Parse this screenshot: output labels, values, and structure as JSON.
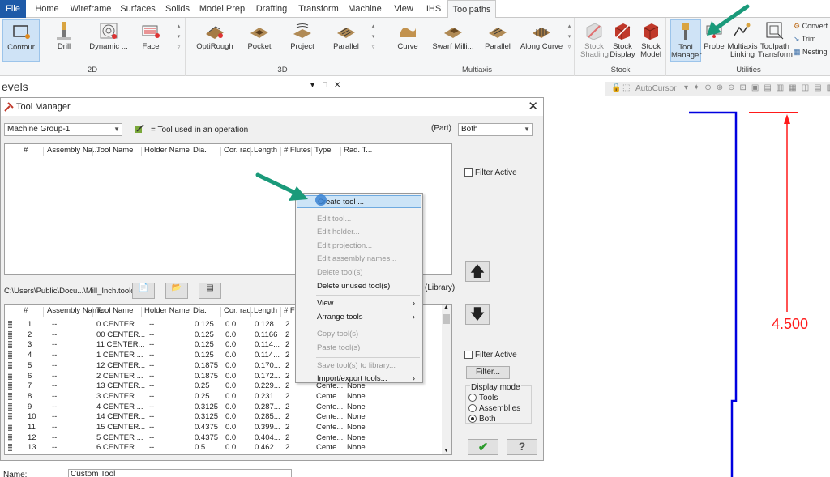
{
  "ribbon": {
    "tabs": [
      "File",
      "Home",
      "Wireframe",
      "Surfaces",
      "Solids",
      "Model Prep",
      "Drafting",
      "Transform",
      "Machine",
      "View",
      "IHS",
      "Toolpaths"
    ],
    "active_tab": "Toolpaths",
    "groups": {
      "2d": {
        "label": "2D",
        "buttons": [
          "Contour",
          "Drill",
          "Dynamic ...",
          "Face"
        ]
      },
      "3d": {
        "label": "3D",
        "buttons": [
          "OptiRough",
          "Pocket",
          "Project",
          "Parallel"
        ]
      },
      "multiaxis": {
        "label": "Multiaxis",
        "buttons": [
          "Curve",
          "Swarf Milli...",
          "Parallel",
          "Along Curve"
        ]
      },
      "stock": {
        "label": "Stock",
        "buttons": [
          [
            "Stock",
            "Shading"
          ],
          [
            "Stock",
            "Display"
          ],
          [
            "Stock",
            "Model"
          ]
        ]
      },
      "utilities": {
        "label": "Utilities",
        "buttons": [
          [
            "Tool",
            "Manager"
          ],
          [
            "Probe",
            ""
          ],
          [
            "Multiaxis",
            "Linking"
          ],
          [
            "Toolpath",
            "Transform"
          ]
        ],
        "small": [
          "Convert",
          "Trim",
          "Nesting"
        ]
      }
    },
    "accent": "#1e5aa8"
  },
  "levels_panel": {
    "title": "evels",
    "controls": [
      "▾",
      "⊓",
      "✕"
    ]
  },
  "graphics": {
    "autocursor": "AutoCursor",
    "dimension": "4.500"
  },
  "tool_manager": {
    "title": "Tool Manager",
    "machine_group": "Machine Group-1",
    "used_legend": "= Tool used in an operation",
    "part_label": "(Part)",
    "part_filter": "Both",
    "filter_active": "Filter Active",
    "columns": [
      "#",
      "Assembly Na...",
      "Tool Name",
      "Holder Name",
      "Dia.",
      "Cor. rad.",
      "Length",
      "# Flutes",
      "Type",
      "Rad. T..."
    ],
    "library_path": "C:\\Users\\Public\\Docu...\\Mill_Inch.tooldb",
    "library_label": "(Library)",
    "library_columns": [
      "#",
      "Assembly Name",
      "Tool Name",
      "Holder Name",
      "Dia.",
      "Cor. rad.",
      "Length",
      "# Fl"
    ],
    "library_rows": [
      {
        "num": "1",
        "asm": "--",
        "name": "0 CENTER ...",
        "holder": "--",
        "dia": "0.125",
        "cor": "0.0",
        "len": "0.128...",
        "fl": "2"
      },
      {
        "num": "2",
        "asm": "--",
        "name": "00 CENTER...",
        "holder": "--",
        "dia": "0.125",
        "cor": "0.0",
        "len": "0.1166",
        "fl": "2"
      },
      {
        "num": "3",
        "asm": "--",
        "name": "11 CENTER...",
        "holder": "--",
        "dia": "0.125",
        "cor": "0.0",
        "len": "0.114...",
        "fl": "2"
      },
      {
        "num": "4",
        "asm": "--",
        "name": "1 CENTER ...",
        "holder": "--",
        "dia": "0.125",
        "cor": "0.0",
        "len": "0.114...",
        "fl": "2"
      },
      {
        "num": "5",
        "asm": "--",
        "name": "12 CENTER...",
        "holder": "--",
        "dia": "0.1875",
        "cor": "0.0",
        "len": "0.170...",
        "fl": "2"
      },
      {
        "num": "6",
        "asm": "--",
        "name": "2 CENTER ...",
        "holder": "--",
        "dia": "0.1875",
        "cor": "0.0",
        "len": "0.172...",
        "fl": "2"
      },
      {
        "num": "7",
        "asm": "--",
        "name": "13 CENTER...",
        "holder": "--",
        "dia": "0.25",
        "cor": "0.0",
        "len": "0.229...",
        "fl": "2",
        "type": "Cente...",
        "rad": "None"
      },
      {
        "num": "8",
        "asm": "--",
        "name": "3 CENTER ...",
        "holder": "--",
        "dia": "0.25",
        "cor": "0.0",
        "len": "0.231...",
        "fl": "2",
        "type": "Cente...",
        "rad": "None"
      },
      {
        "num": "9",
        "asm": "--",
        "name": "4 CENTER ...",
        "holder": "--",
        "dia": "0.3125",
        "cor": "0.0",
        "len": "0.287...",
        "fl": "2",
        "type": "Cente...",
        "rad": "None"
      },
      {
        "num": "10",
        "asm": "--",
        "name": "14 CENTER...",
        "holder": "--",
        "dia": "0.3125",
        "cor": "0.0",
        "len": "0.285...",
        "fl": "2",
        "type": "Cente...",
        "rad": "None"
      },
      {
        "num": "11",
        "asm": "--",
        "name": "15 CENTER...",
        "holder": "--",
        "dia": "0.4375",
        "cor": "0.0",
        "len": "0.399...",
        "fl": "2",
        "type": "Cente...",
        "rad": "None"
      },
      {
        "num": "12",
        "asm": "--",
        "name": "5 CENTER ...",
        "holder": "--",
        "dia": "0.4375",
        "cor": "0.0",
        "len": "0.404...",
        "fl": "2",
        "type": "Cente...",
        "rad": "None"
      },
      {
        "num": "13",
        "asm": "--",
        "name": "6 CENTER ...",
        "holder": "--",
        "dia": "0.5",
        "cor": "0.0",
        "len": "0.462...",
        "fl": "2",
        "type": "Cente...",
        "rad": "None"
      }
    ],
    "filter_button": "Filter...",
    "display_mode": {
      "label": "Display mode",
      "options": [
        "Tools",
        "Assemblies",
        "Both"
      ],
      "selected": "Both"
    },
    "name_label": "Name:",
    "name_value": "Custom Tool"
  },
  "context_menu": {
    "items": [
      {
        "label": "Create tool ...",
        "enabled": true,
        "highlight": true
      },
      {
        "label": "Edit tool...",
        "enabled": false
      },
      {
        "label": "Edit holder...",
        "enabled": false
      },
      {
        "label": "Edit projection...",
        "enabled": false
      },
      {
        "label": "Edit assembly names...",
        "enabled": false
      },
      {
        "label": "Delete tool(s)",
        "enabled": false
      },
      {
        "label": "Delete unused tool(s)",
        "enabled": true
      },
      {
        "label": "View",
        "enabled": true,
        "submenu": true
      },
      {
        "label": "Arrange tools",
        "enabled": true,
        "submenu": true
      },
      {
        "label": "Copy tool(s)",
        "enabled": false
      },
      {
        "label": "Paste tool(s)",
        "enabled": false
      },
      {
        "label": "Save tool(s) to library...",
        "enabled": false
      },
      {
        "label": "Import/export tools...",
        "enabled": true,
        "submenu": true
      }
    ]
  }
}
